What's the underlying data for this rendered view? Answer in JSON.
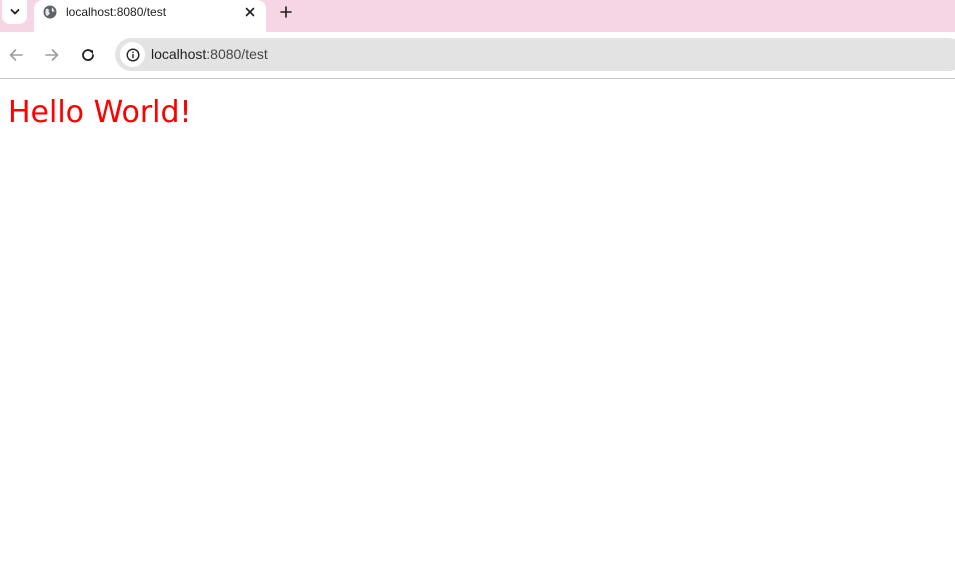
{
  "browser": {
    "tab": {
      "title": "localhost:8080/test",
      "favicon": "globe-icon"
    },
    "address_bar": {
      "host": "localhost",
      "path": ":8080/test"
    },
    "icons": {
      "tab_search": "chevron-down-icon",
      "tab_close": "close-icon",
      "new_tab": "plus-icon",
      "back": "arrow-left-icon",
      "forward": "arrow-right-icon",
      "reload": "reload-icon",
      "site_info": "info-icon"
    },
    "colors": {
      "tabstrip": "#f6d5e5",
      "omnibox": "#e3e3e3"
    }
  },
  "page": {
    "greeting": "Hello World!",
    "greeting_color": "#ff0000"
  }
}
